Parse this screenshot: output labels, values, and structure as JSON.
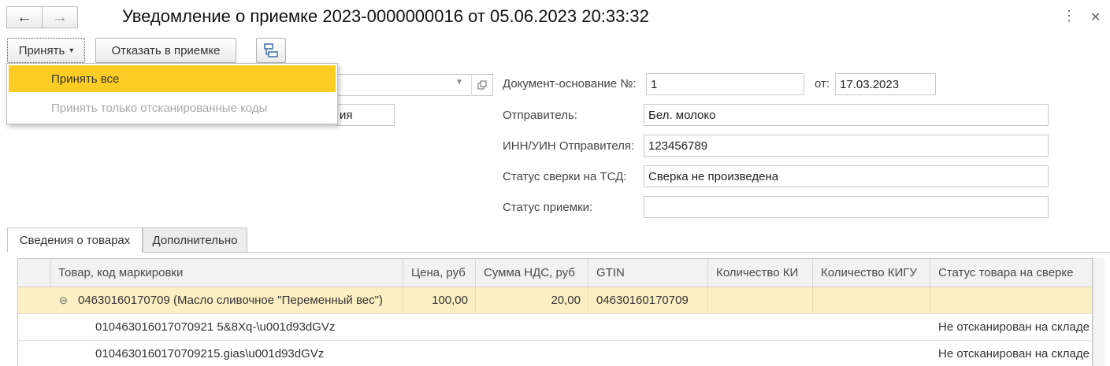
{
  "window": {
    "title": "Уведомление о приемке 2023-0000000016 от 05.06.2023 20:33:32",
    "back_icon": "←",
    "forward_icon": "→",
    "more_icon": "⋮",
    "close_icon": "✕"
  },
  "toolbar": {
    "accept_label": "Принять",
    "dropdown_arrow": "▾",
    "reject_label": "Отказать в приемке",
    "structure_icon": "structure-icon"
  },
  "accept_menu": {
    "items": [
      {
        "label": "Принять все",
        "enabled": true
      },
      {
        "label": "Принять только отсканированные коды",
        "enabled": false
      }
    ]
  },
  "left_form": {
    "combo_value": "",
    "partial_value": "ия"
  },
  "right_form": {
    "doc_basis_label": "Документ-основание №:",
    "doc_basis_value": "1",
    "date_label": "от:",
    "date_value": "17.03.2023",
    "sender_label": "Отправитель:",
    "sender_value": "Бел. молоко",
    "inn_label": "ИНН/УИН Отправителя:",
    "inn_value": "123456789",
    "tsd_status_label": "Статус сверки на ТСД:",
    "tsd_status_value": "Сверка не произведена",
    "accept_status_label": "Статус приемки:",
    "accept_status_value": ""
  },
  "tabs": [
    {
      "label": "Сведения о товарах",
      "active": true
    },
    {
      "label": "Дополнительно",
      "active": false
    }
  ],
  "table": {
    "columns": [
      "Товар, код маркировки",
      "Цена, руб",
      "Сумма НДС, руб",
      "GTIN",
      "Количество КИ",
      "Количество КИГУ",
      "Статус товара на сверке"
    ],
    "rows": [
      {
        "collapse": "⊖",
        "product": "04630160170709 (Масло сливочное \"Переменный вес\")",
        "price": "100,00",
        "vat": "20,00",
        "gtin": "04630160170709",
        "qty_ki": "",
        "qty_kigu": "",
        "status": ""
      },
      {
        "product": "010463016017070921 5&8Xq-\\u001d93dGVz",
        "price": "",
        "vat": "",
        "gtin": "",
        "qty_ki": "",
        "qty_kigu": "",
        "status": "Не отсканирован на складе"
      },
      {
        "product": "0104630160170709215.gias\\u001d93dGVz",
        "price": "",
        "vat": "",
        "gtin": "",
        "qty_ki": "",
        "qty_kigu": "",
        "status": "Не отсканирован на складе"
      }
    ]
  },
  "colors": {
    "menu_highlight": "#fbcc23",
    "selected_row": "#fcefc4",
    "header_bg": "#f2f2f2"
  }
}
